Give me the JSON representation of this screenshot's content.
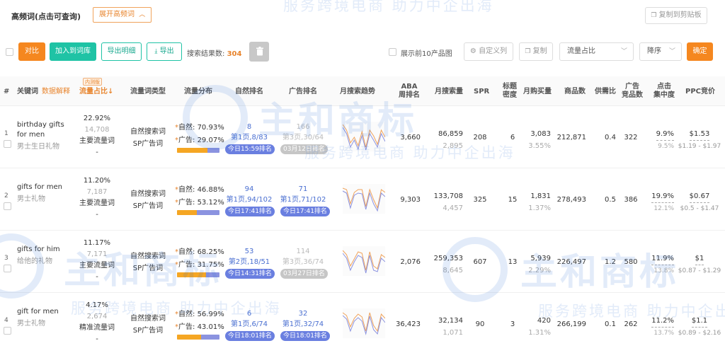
{
  "header": {
    "title": "高频词(点击可查询)",
    "expand_label": "展开高频词",
    "copy_label": "复制到剪贴板"
  },
  "toolbar": {
    "compare": "对比",
    "add_to_lib": "加入到词库",
    "export_detail": "导出明细",
    "export": "导出",
    "result_label": "搜索结果数:",
    "result_count": "304",
    "top10_label": "展示前10产品图",
    "custom_cols": "自定义列",
    "copy": "复制",
    "sort_field": "流量占比",
    "sort_order": "降序",
    "confirm": "确定"
  },
  "columns": {
    "index": "#",
    "keyword": "关键词",
    "data_explain": "数据解释",
    "internal_badge": "内测版",
    "traffic_share": "流量占比↓",
    "traffic_type": "流量词类型",
    "traffic_dist": "流量分布",
    "organic_rank": "自然排名",
    "ad_rank": "广告排名",
    "monthly_trend": "月搜索趋势",
    "aba_rank_1": "ABA",
    "aba_rank_2": "周排名",
    "monthly_search": "月搜索量",
    "spr": "SPR",
    "title_density_1": "标题",
    "title_density_2": "密度",
    "monthly_purchase": "月购买量",
    "product_count": "商品数",
    "supply_ratio": "供需比",
    "ad_products_1": "广告",
    "ad_products_2": "竞品数",
    "click_conc_1": "点击",
    "click_conc_2": "集中度",
    "ppc": "PPC竞价"
  },
  "rows": [
    {
      "index": "1",
      "keyword_1": "birthday gifts",
      "keyword_2": "for men",
      "keyword_cn": "男士生日礼物",
      "share": "22.92%",
      "share_count": "14,708",
      "share_type": "主要流量词",
      "share_dash": "-",
      "type_1": "自然搜索词",
      "type_2": "SP广告词",
      "organic_label": "自然:",
      "organic_pct": "70.93%",
      "ad_label": "广告:",
      "ad_pct": "29.07%",
      "organic_share": 70.93,
      "organic_rank": "8",
      "organic_page": "第1页,8/83",
      "organic_pill": "今日15:59排名",
      "ad_rank": "166",
      "ad_page": "第3页,30/64",
      "ad_pill": "03月12日排名",
      "ad_gray": true,
      "aba": "3,660",
      "search": "86,859",
      "search_sub": "2,895",
      "spr": "208",
      "density": "6",
      "purchase": "3,083",
      "purchase_pct": "3.55%",
      "products": "212,871",
      "supply": "0.4",
      "ad_products": "322",
      "click": "9.9%",
      "click_sub": "9.5%",
      "ppc": "$1.53",
      "ppc_range": "$1.19 - $1.97",
      "trend": [
        38,
        30,
        12,
        20,
        8,
        28,
        6,
        30,
        22,
        10,
        30,
        20
      ]
    },
    {
      "index": "2",
      "keyword_1": "gifts for men",
      "keyword_2": "",
      "keyword_cn": "男士礼物",
      "share": "11.20%",
      "share_count": "7,187",
      "share_type": "主要流量词",
      "share_dash": "-",
      "type_1": "自然搜索词",
      "type_2": "SP广告词",
      "organic_label": "自然:",
      "organic_pct": "46.88%",
      "ad_label": "广告:",
      "ad_pct": "53.12%",
      "organic_share": 46.88,
      "organic_rank": "94",
      "organic_page": "第1页,94/102",
      "organic_pill": "今日17:41排名",
      "ad_rank": "71",
      "ad_page": "第1页,71/102",
      "ad_pill": "今日17:41排名",
      "ad_gray": false,
      "aba": "9,303",
      "search": "133,708",
      "search_sub": "4,457",
      "spr": "325",
      "density": "15",
      "purchase": "1,831",
      "purchase_pct": "1.37%",
      "products": "278,493",
      "supply": "0.5",
      "ad_products": "386",
      "click": "19.9%",
      "click_sub": "12.1%",
      "ppc": "$0.67",
      "ppc_range": "$0.5 - $1.47",
      "trend": [
        36,
        34,
        14,
        30,
        34,
        34,
        10,
        34,
        20,
        8,
        34,
        30
      ]
    },
    {
      "index": "3",
      "keyword_1": "gifts for him",
      "keyword_2": "",
      "keyword_cn": "给他的礼物",
      "share": "11.17%",
      "share_count": "7,171",
      "share_type": "主要流量词",
      "share_dash": "-",
      "type_1": "自然搜索词",
      "type_2": "SP广告词",
      "organic_label": "自然:",
      "organic_pct": "68.25%",
      "ad_label": "广告:",
      "ad_pct": "31.75%",
      "organic_share": 68.25,
      "organic_rank": "53",
      "organic_page": "第2页,18/51",
      "organic_pill": "今日14:31排名",
      "ad_rank": "114",
      "ad_page": "第3页,36/74",
      "ad_pill": "03月27日排名",
      "ad_gray": true,
      "aba": "2,076",
      "search": "259,353",
      "search_sub": "8,645",
      "spr": "607",
      "density": "13",
      "purchase": "5,939",
      "purchase_pct": "2.29%",
      "products": "226,497",
      "supply": "1.2",
      "ad_products": "580",
      "click": "11.9%",
      "click_sub": "13.8%",
      "ppc": "$1",
      "ppc_range": "$0.87 - $1.29",
      "trend": [
        36,
        30,
        14,
        24,
        34,
        32,
        8,
        34,
        14,
        10,
        30,
        26
      ]
    },
    {
      "index": "4",
      "keyword_1": "gift for men",
      "keyword_2": "",
      "keyword_cn": "男士礼物",
      "share": "4.17%",
      "share_count": "2,674",
      "share_type": "精准流量词",
      "share_dash": "-",
      "type_1": "自然搜索词",
      "type_2": "SP广告词",
      "organic_label": "自然:",
      "organic_pct": "56.99%",
      "ad_label": "广告:",
      "ad_pct": "43.01%",
      "organic_share": 56.99,
      "organic_rank": "6",
      "organic_page": "第1页,6/74",
      "organic_pill": "今日18:01排名",
      "ad_rank": "32",
      "ad_page": "第1页,32/74",
      "ad_pill": "今日18:01排名",
      "ad_gray": false,
      "aba": "36,423",
      "search": "32,134",
      "search_sub": "1,071",
      "spr": "90",
      "density": "3",
      "purchase": "420",
      "purchase_pct": "1.31%",
      "products": "266,199",
      "supply": "0.1",
      "ad_products": "262",
      "click": "11.2%",
      "click_sub": "13.7%",
      "ppc": "$1.1",
      "ppc_range": "$0.89 - $2.16",
      "trend": [
        36,
        32,
        16,
        28,
        34,
        30,
        10,
        36,
        18,
        10,
        34,
        28
      ]
    }
  ],
  "watermark": {
    "logo": "主和商标",
    "sub": "服务跨境电商  助力中企出海"
  },
  "colors": {
    "accent_orange": "#f5871f",
    "teal": "#1fc3a5",
    "rank_blue": "#4a6fd1",
    "bar_organic": "#f5a623",
    "bar_ad": "#8b93e0"
  }
}
